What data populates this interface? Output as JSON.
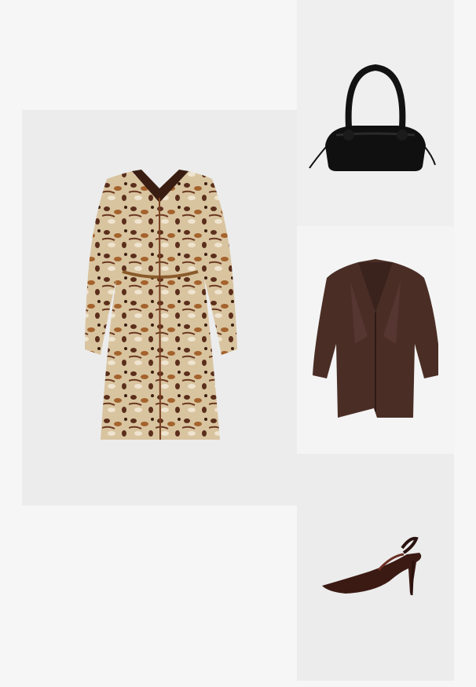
{
  "outfit": {
    "items": [
      {
        "id": "dress",
        "icon": "leopard-print-dress-image",
        "print_colors": [
          "#d8c3a0",
          "#5b2e1b",
          "#a4622c",
          "#efe4cf"
        ]
      },
      {
        "id": "bag",
        "icon": "black-handbag-image",
        "colors": [
          "#101010",
          "#2a2a2a"
        ]
      },
      {
        "id": "blazer",
        "icon": "brown-blazer-image",
        "colors": [
          "#4a2e26",
          "#3a231d"
        ]
      },
      {
        "id": "shoe",
        "icon": "slingback-pump-image",
        "colors": [
          "#3b1a14",
          "#6b2f24"
        ]
      }
    ]
  }
}
